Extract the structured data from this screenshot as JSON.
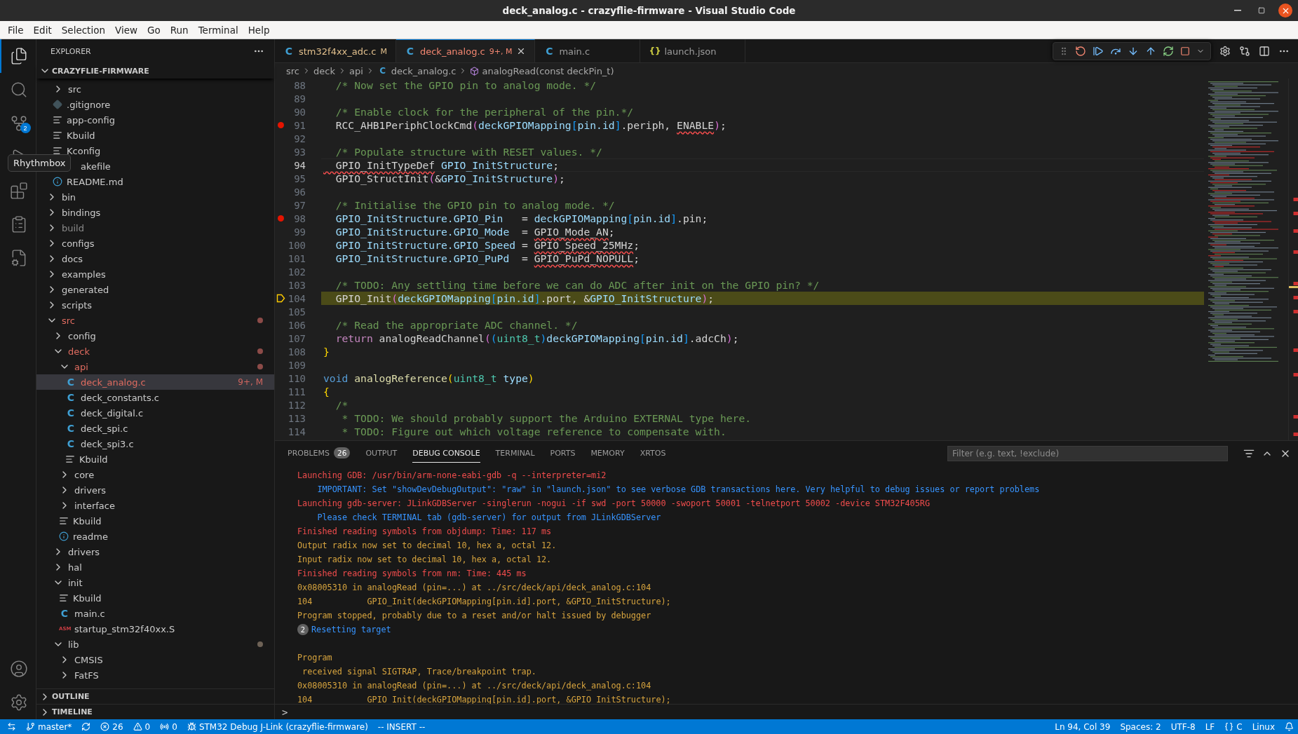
{
  "window": {
    "title": "deck_analog.c - crazyflie-firmware - Visual Studio Code"
  },
  "menu": [
    "File",
    "Edit",
    "Selection",
    "View",
    "Go",
    "Run",
    "Terminal",
    "Help"
  ],
  "activity_bar": {
    "items": [
      {
        "kind": "explorer",
        "selected": true
      },
      {
        "kind": "search",
        "selected": false
      },
      {
        "kind": "source-control",
        "selected": false,
        "badge": "2"
      },
      {
        "kind": "run",
        "selected": false
      },
      {
        "kind": "extensions",
        "selected": false
      },
      {
        "kind": "remote",
        "selected": false
      },
      {
        "kind": "cmake",
        "selected": false
      }
    ],
    "bottom": [
      {
        "kind": "account"
      },
      {
        "kind": "settings"
      }
    ]
  },
  "tooltip": "Rhythmbox",
  "explorer": {
    "title": "EXPLORER",
    "project": "CRAZYFLIE-FIRMWARE",
    "tree": [
      {
        "children": [
          {
            "label": "src",
            "kind": "folder",
            "expanded": false
          },
          {
            "label": ".gitignore",
            "kind": "git"
          },
          {
            "label": "app-config",
            "kind": "text"
          },
          {
            "label": "Kbuild",
            "kind": "text"
          },
          {
            "label": "Kconfig",
            "kind": "text"
          },
          {
            "label": "akefile",
            "kind": "covered"
          },
          {
            "label": "README.md",
            "kind": "info"
          }
        ]
      },
      {
        "label": "bin",
        "kind": "folder",
        "expanded": false
      },
      {
        "label": "bindings",
        "kind": "folder",
        "expanded": false
      },
      {
        "label": "build",
        "kind": "folder",
        "expanded": false,
        "dimmed": true
      },
      {
        "label": "configs",
        "kind": "folder",
        "expanded": false
      },
      {
        "label": "docs",
        "kind": "folder",
        "expanded": false
      },
      {
        "label": "examples",
        "kind": "folder",
        "expanded": false
      },
      {
        "label": "generated",
        "kind": "folder",
        "expanded": false
      },
      {
        "label": "scripts",
        "kind": "folder",
        "expanded": false
      },
      {
        "label": "src",
        "kind": "folder",
        "expanded": true,
        "modified": true,
        "color": "#8c4b48",
        "children": [
          {
            "label": "config",
            "kind": "folder",
            "expanded": false
          },
          {
            "label": "deck",
            "kind": "folder",
            "expanded": true,
            "modified": true,
            "color": "#8c4b48",
            "children": [
              {
                "label": "api",
                "kind": "folder",
                "expanded": true,
                "modified": true,
                "color": "#8c4b48",
                "children": [
                  {
                    "label": "deck_analog.c",
                    "kind": "c",
                    "icon": "C",
                    "modified": true,
                    "selected": true,
                    "badge": "9+, M"
                  },
                  {
                    "label": "deck_constants.c",
                    "kind": "c",
                    "icon": "C",
                    "selected": false
                  },
                  {
                    "label": "deck_digital.c",
                    "kind": "c",
                    "icon": "C",
                    "selected": false
                  },
                  {
                    "label": "deck_spi.c",
                    "kind": "c",
                    "icon": "C",
                    "selected": false
                  },
                  {
                    "label": "deck_spi3.c",
                    "kind": "c",
                    "icon": "C",
                    "selected": false
                  },
                  {
                    "label": "Kbuild",
                    "kind": "text"
                  }
                ]
              },
              {
                "label": "core",
                "kind": "folder",
                "expanded": false
              },
              {
                "label": "drivers",
                "kind": "folder",
                "expanded": false
              },
              {
                "label": "interface",
                "kind": "folder",
                "expanded": false
              },
              {
                "label": "Kbuild",
                "kind": "text"
              },
              {
                "label": "readme",
                "kind": "info"
              }
            ]
          },
          {
            "label": "drivers",
            "kind": "folder",
            "expanded": false
          },
          {
            "label": "hal",
            "kind": "folder",
            "expanded": false
          },
          {
            "label": "init",
            "kind": "folder",
            "expanded": true,
            "children": [
              {
                "label": "Kbuild",
                "kind": "text"
              },
              {
                "label": "main.c",
                "kind": "c",
                "icon": "C",
                "selected": false
              },
              {
                "label": "startup_stm32f40xx.S",
                "kind": "asm",
                "icon": "ASM"
              }
            ]
          },
          {
            "label": "lib",
            "kind": "folder",
            "expanded": true,
            "color": "#6e6256",
            "children": [
              {
                "label": "CMSIS",
                "kind": "folder",
                "expanded": false
              },
              {
                "label": "FatFS",
                "kind": "folder",
                "expanded": false
              }
            ]
          }
        ]
      }
    ],
    "sections": [
      {
        "label": "OUTLINE",
        "expanded": false
      },
      {
        "label": "TIMELINE",
        "expanded": false
      }
    ]
  },
  "tabs": [
    {
      "label": "stm32f4xx_adc.c",
      "icon": "C",
      "kind": "c",
      "badge": "M",
      "color": "#e2c08d",
      "selected": false
    },
    {
      "label": "deck_analog.c",
      "icon": "C",
      "kind": "c",
      "badge": "9+, M",
      "color": "#f48771",
      "selected": true
    },
    {
      "label": "main.c",
      "icon": "C",
      "kind": "c",
      "color": "#9d9d9d",
      "selected": false
    },
    {
      "label": "launch.json",
      "icon": "{}",
      "kind": "json",
      "color": "#9d9d9d",
      "selected": false
    }
  ],
  "breadcrumb": [
    {
      "label": "src",
      "kind": "folder"
    },
    {
      "label": "deck",
      "kind": "folder"
    },
    {
      "label": "api",
      "kind": "folder"
    },
    {
      "label": "deck_analog.c",
      "kind": "c",
      "icon": "C"
    },
    {
      "label": "analogRead(const deckPin_t)",
      "kind": "symbol"
    }
  ],
  "editor": {
    "lines": [
      {
        "n": "88",
        "kind": "plain",
        "active": false,
        "tokens": [
          {
            "text": "  /* Now set the GPIO pin to analog mode. */",
            "kind": "comment"
          }
        ]
      },
      {
        "n": "89",
        "kind": "plain",
        "active": false
      },
      {
        "n": "90",
        "kind": "plain",
        "active": false,
        "tokens": [
          {
            "text": "  /* Enable clock for the peripheral of the pin.*/",
            "kind": "comment"
          }
        ]
      },
      {
        "n": "91",
        "kind": "breakpoint",
        "active": false,
        "tokens": [
          {
            "text": "  RCC_AHB1PeriphClockCmd",
            "kind": "plain"
          },
          {
            "text": "(",
            "kind": "bracket2"
          },
          {
            "text": "deckGPIOMapping",
            "kind": "var"
          },
          {
            "text": "[",
            "kind": "bracket3"
          },
          {
            "text": "pin.id",
            "kind": "var"
          },
          {
            "text": "]",
            "kind": "bracket3"
          },
          {
            "text": ".periph, ",
            "kind": "plain"
          },
          {
            "text": "ENABLE",
            "kind": "plain",
            "error": true
          },
          {
            "text": ")",
            "kind": "bracket2"
          },
          {
            "text": ";",
            "kind": "plain"
          }
        ]
      },
      {
        "n": "92",
        "kind": "plain",
        "active": false
      },
      {
        "n": "93",
        "kind": "plain",
        "active": false,
        "tokens": [
          {
            "text": "  /* Populate structure with RESET values. */",
            "kind": "comment"
          }
        ]
      },
      {
        "n": "94",
        "kind": "plain",
        "active": true,
        "tokens": [
          {
            "text": "  GPIO_InitTypeDef",
            "kind": "plain",
            "error": true
          },
          {
            "text": " GPIO_InitStructure",
            "kind": "var"
          },
          {
            "text": ";",
            "kind": "plain"
          }
        ]
      },
      {
        "n": "95",
        "kind": "plain",
        "active": false,
        "tokens": [
          {
            "text": "  GPIO_StructInit",
            "kind": "plain"
          },
          {
            "text": "(",
            "kind": "bracket2"
          },
          {
            "text": "&",
            "kind": "plain"
          },
          {
            "text": "GPIO_InitStructure",
            "kind": "var"
          },
          {
            "text": ")",
            "kind": "bracket2"
          },
          {
            "text": ";",
            "kind": "plain"
          }
        ]
      },
      {
        "n": "96",
        "kind": "plain",
        "active": false
      },
      {
        "n": "97",
        "kind": "plain",
        "active": false,
        "tokens": [
          {
            "text": "  /* Initialise the GPIO pin to analog mode. */",
            "kind": "comment"
          }
        ]
      },
      {
        "n": "98",
        "kind": "breakpoint",
        "active": false,
        "tokens": [
          {
            "text": "  GPIO_InitStructure.GPIO_Pin",
            "kind": "var"
          },
          {
            "text": "   = ",
            "kind": "plain"
          },
          {
            "text": "deckGPIOMapping",
            "kind": "var"
          },
          {
            "text": "[",
            "kind": "bracket3"
          },
          {
            "text": "pin.id",
            "kind": "var"
          },
          {
            "text": "]",
            "kind": "bracket3"
          },
          {
            "text": ".pin;",
            "kind": "plain"
          }
        ]
      },
      {
        "n": "99",
        "kind": "plain",
        "active": false,
        "tokens": [
          {
            "text": "  GPIO_InitStructure.GPIO_Mode",
            "kind": "var"
          },
          {
            "text": "  = ",
            "kind": "plain"
          },
          {
            "text": "GPIO_Mode_AN",
            "kind": "plain",
            "error": true
          },
          {
            "text": ";",
            "kind": "plain"
          }
        ]
      },
      {
        "n": "100",
        "kind": "plain",
        "active": false,
        "tokens": [
          {
            "text": "  GPIO_InitStructure.GPIO_Speed",
            "kind": "var"
          },
          {
            "text": " = ",
            "kind": "plain"
          },
          {
            "text": "GPIO_Speed_25MHz",
            "kind": "plain",
            "error": true
          },
          {
            "text": ";",
            "kind": "plain"
          }
        ]
      },
      {
        "n": "101",
        "kind": "plain",
        "active": false,
        "tokens": [
          {
            "text": "  GPIO_InitStructure.GPIO_PuPd",
            "kind": "var"
          },
          {
            "text": "  = ",
            "kind": "plain"
          },
          {
            "text": "GPIO_PuPd_NOPULL",
            "kind": "plain",
            "error": true
          },
          {
            "text": ";",
            "kind": "plain"
          }
        ]
      },
      {
        "n": "102",
        "kind": "plain",
        "active": false
      },
      {
        "n": "103",
        "kind": "plain",
        "active": false,
        "tokens": [
          {
            "text": "  /* TODO: Any settling time before we can do ADC after init on the GPIO pin? */",
            "kind": "comment"
          }
        ]
      },
      {
        "n": "104",
        "kind": "stopped",
        "active": false,
        "tokens": [
          {
            "text": "  GPIO_Init",
            "kind": "plain"
          },
          {
            "text": "(",
            "kind": "bracket2"
          },
          {
            "text": "deckGPIOMapping",
            "kind": "var"
          },
          {
            "text": "[",
            "kind": "bracket3"
          },
          {
            "text": "pin.id",
            "kind": "var"
          },
          {
            "text": "]",
            "kind": "bracket3"
          },
          {
            "text": ".port, &",
            "kind": "plain"
          },
          {
            "text": "GPIO_InitStructure",
            "kind": "var"
          },
          {
            "text": ")",
            "kind": "bracket2"
          },
          {
            "text": ";",
            "kind": "plain"
          }
        ]
      },
      {
        "n": "105",
        "kind": "plain",
        "active": false
      },
      {
        "n": "106",
        "kind": "plain",
        "active": false,
        "tokens": [
          {
            "text": "  /* Read the appropriate ADC channel. */",
            "kind": "comment"
          }
        ]
      },
      {
        "n": "107",
        "kind": "plain",
        "active": false,
        "tokens": [
          {
            "text": "  return",
            "kind": "control"
          },
          {
            "text": " analogReadChannel",
            "kind": "plain"
          },
          {
            "text": "(",
            "kind": "bracket2"
          },
          {
            "text": "(",
            "kind": "bracket3"
          },
          {
            "text": "uint8_t",
            "kind": "type"
          },
          {
            "text": ")",
            "kind": "bracket3"
          },
          {
            "text": "deckGPIOMapping",
            "kind": "var"
          },
          {
            "text": "[",
            "kind": "bracket3"
          },
          {
            "text": "pin.id",
            "kind": "var"
          },
          {
            "text": "]",
            "kind": "bracket3"
          },
          {
            "text": ".adcCh",
            "kind": "plain"
          },
          {
            "text": ")",
            "kind": "bracket2"
          },
          {
            "text": ";",
            "kind": "plain"
          }
        ]
      },
      {
        "n": "108",
        "kind": "plain",
        "active": false,
        "tokens": [
          {
            "text": "}",
            "kind": "bracket1"
          }
        ]
      },
      {
        "n": "109",
        "kind": "plain",
        "active": false
      },
      {
        "n": "110",
        "kind": "plain",
        "active": false,
        "tokens": [
          {
            "text": "void",
            "kind": "keyword"
          },
          {
            "text": " analogReference",
            "kind": "func"
          },
          {
            "text": "(",
            "kind": "bracket1"
          },
          {
            "text": "uint8_t",
            "kind": "type"
          },
          {
            "text": " type",
            "kind": "var"
          },
          {
            "text": ")",
            "kind": "bracket1"
          }
        ]
      },
      {
        "n": "111",
        "kind": "plain",
        "active": false,
        "tokens": [
          {
            "text": "{",
            "kind": "bracket1"
          }
        ]
      },
      {
        "n": "112",
        "kind": "plain",
        "active": false,
        "tokens": [
          {
            "text": "  /*",
            "kind": "comment"
          }
        ]
      },
      {
        "n": "113",
        "kind": "plain",
        "active": false,
        "tokens": [
          {
            "text": "   * TODO: We should probably support the Arduino EXTERNAL type here.",
            "kind": "comment"
          }
        ]
      },
      {
        "n": "114",
        "kind": "plain",
        "active": false,
        "tokens": [
          {
            "text": "   * TODO: Figure out which voltage reference to compensate with.",
            "kind": "comment"
          }
        ]
      }
    ]
  },
  "panel": {
    "tabs": [
      {
        "label": "PROBLEMS",
        "badge": "26",
        "selected": false
      },
      {
        "label": "OUTPUT",
        "selected": false
      },
      {
        "label": "DEBUG CONSOLE",
        "selected": true
      },
      {
        "label": "TERMINAL",
        "selected": false
      },
      {
        "label": "PORTS",
        "selected": false
      },
      {
        "label": "MEMORY",
        "selected": false
      },
      {
        "label": "XRTOS",
        "selected": false
      }
    ],
    "filter": {
      "placeholder": "Filter (e.g. text, !exclude)"
    },
    "console": [
      {
        "kind": "stderr",
        "text": "Launching GDB: /usr/bin/arm-none-eabi-gdb -q --interpreter=mi2"
      },
      {
        "kind": "info",
        "text": "    IMPORTANT: Set \"showDevDebugOutput\": \"raw\" in \"launch.json\" to see verbose GDB transactions here. Very helpful to debug issues or report problems"
      },
      {
        "kind": "stderr",
        "text": "Launching gdb-server: JLinkGDBServer -singlerun -nogui -if swd -port 50000 -swoport 50001 -telnetport 50002 -device STM32F405RG"
      },
      {
        "kind": "info",
        "text": "    Please check TERMINAL tab (gdb-server) for output from JLinkGDBServer"
      },
      {
        "kind": "stderr",
        "text": "Finished reading symbols from objdump: Time: 117 ms"
      },
      {
        "kind": "stdout",
        "text": "Output radix now set to decimal 10, hex a, octal 12."
      },
      {
        "kind": "stdout",
        "text": "Input radix now set to decimal 10, hex a, octal 12."
      },
      {
        "kind": "stderr",
        "text": "Finished reading symbols from nm: Time: 445 ms"
      },
      {
        "kind": "stdout",
        "text": "0x08005310 in analogRead (pin=...) at ../src/deck/api/deck_analog.c:104"
      },
      {
        "kind": "stdout",
        "text": "104\t      GPIO_Init(deckGPIOMapping[pin.id].port, &GPIO_InitStructure);"
      },
      {
        "kind": "stdout",
        "text": "Program stopped, probably due to a reset and/or halt issued by debugger"
      },
      {
        "kind": "info",
        "count": "2",
        "text": "Resetting target"
      },
      {
        "kind": "blank"
      },
      {
        "kind": "stdout",
        "text": "Program"
      },
      {
        "kind": "stdout",
        "text": " received signal SIGTRAP, Trace/breakpoint trap."
      },
      {
        "kind": "stdout",
        "text": "0x08005310 in analogRead (pin=...) at ../src/deck/api/deck_analog.c:104"
      },
      {
        "kind": "stdout",
        "text": "104\t      GPIO_Init(deckGPIOMapping[pin.id].port, &GPIO_InitStructure);"
      }
    ],
    "prompt": ">"
  },
  "status_bar": {
    "left": [
      {
        "kind": "remote"
      },
      {
        "kind": "branch",
        "text": "master*"
      },
      {
        "kind": "sync"
      },
      {
        "kind": "errors",
        "text": "26"
      },
      {
        "kind": "warnings",
        "text": "0"
      },
      {
        "kind": "ports",
        "text": "0"
      },
      {
        "kind": "debug",
        "text": "STM32 Debug J-Link (crazyflie-firmware)"
      },
      {
        "kind": "plain",
        "text": "-- INSERT --"
      }
    ],
    "right": [
      {
        "kind": "plain",
        "text": "Ln 94, Col 39"
      },
      {
        "kind": "plain",
        "text": "Spaces: 2"
      },
      {
        "kind": "plain",
        "text": "UTF-8"
      },
      {
        "kind": "plain",
        "text": "LF"
      },
      {
        "kind": "language",
        "text": "C"
      },
      {
        "kind": "plain",
        "text": "Linux"
      },
      {
        "kind": "bell"
      }
    ]
  }
}
